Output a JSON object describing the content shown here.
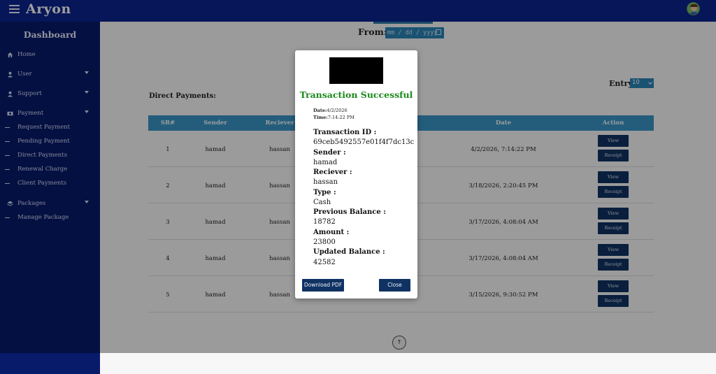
{
  "app": {
    "brand": "Aryon"
  },
  "sidebar": {
    "title": "Dashboard",
    "items": [
      {
        "label": "Home",
        "icon": "home-icon",
        "has_caret": false
      },
      {
        "label": "User",
        "icon": "user-icon",
        "has_caret": true
      },
      {
        "label": "Support",
        "icon": "user-icon",
        "has_caret": true
      },
      {
        "label": "Payment",
        "icon": "money-icon",
        "has_caret": true
      },
      {
        "label": "Packages",
        "icon": "layers-icon",
        "has_caret": true
      }
    ],
    "payment_subitems": [
      "Request Payment",
      "Pending Payment",
      "Direct Payments",
      "Renewal Charge",
      "Client Payments"
    ],
    "packages_subitems": [
      "Manage Package"
    ]
  },
  "filters": {
    "from_label": "From:",
    "date_placeholder": "mm / dd / yyyy",
    "entry_label": "Entry:",
    "entry_value": "10"
  },
  "table": {
    "section_title": "Direct Payments:",
    "columns": [
      "SR#",
      "Sender",
      "Reciever",
      "Date",
      "Action"
    ],
    "rows": [
      {
        "sr": "1",
        "sender": "hamad",
        "receiver": "hassan",
        "date": "4/2/2026, 7:14:22 PM"
      },
      {
        "sr": "2",
        "sender": "hamad",
        "receiver": "hassan",
        "date": "3/18/2026, 2:20:45 PM"
      },
      {
        "sr": "3",
        "sender": "hamad",
        "receiver": "hassan",
        "date": "3/17/2026, 4:08:04 AM"
      },
      {
        "sr": "4",
        "sender": "hamad",
        "receiver": "hassan",
        "date": "3/17/2026, 4:08:04 AM"
      },
      {
        "sr": "5",
        "sender": "hamad",
        "receiver": "hassan",
        "date": "3/15/2026, 9:30:52 PM"
      }
    ],
    "view_label": "View",
    "receipt_label": "Receipt",
    "scroll_glyph": "↑"
  },
  "modal": {
    "title": "Transaction Successful",
    "date_label": "Date:",
    "date_value": "4/2/2026",
    "time_label": "Time:",
    "time_value": "7:14:22 PM",
    "fields": [
      {
        "label": "Transaction ID :",
        "value": "69ceb5492557e01f4f7dc13c"
      },
      {
        "label": "Sender :",
        "value": "hamad"
      },
      {
        "label": "Reciever :",
        "value": "hassan"
      },
      {
        "label": "Type :",
        "value": "Cash"
      },
      {
        "label": "Previous Balance :",
        "value": "18782"
      },
      {
        "label": "Amount :",
        "value": "23800"
      },
      {
        "label": "Updated Balance :",
        "value": "42582"
      }
    ],
    "download_label": "Download PDF",
    "close_label": "Close",
    "title_color": "#1a8a1a"
  },
  "colors": {
    "topbar": "#0a2590",
    "sidebar": "#081a6a",
    "table_header": "#3a97c9",
    "button": "#0f3263"
  }
}
